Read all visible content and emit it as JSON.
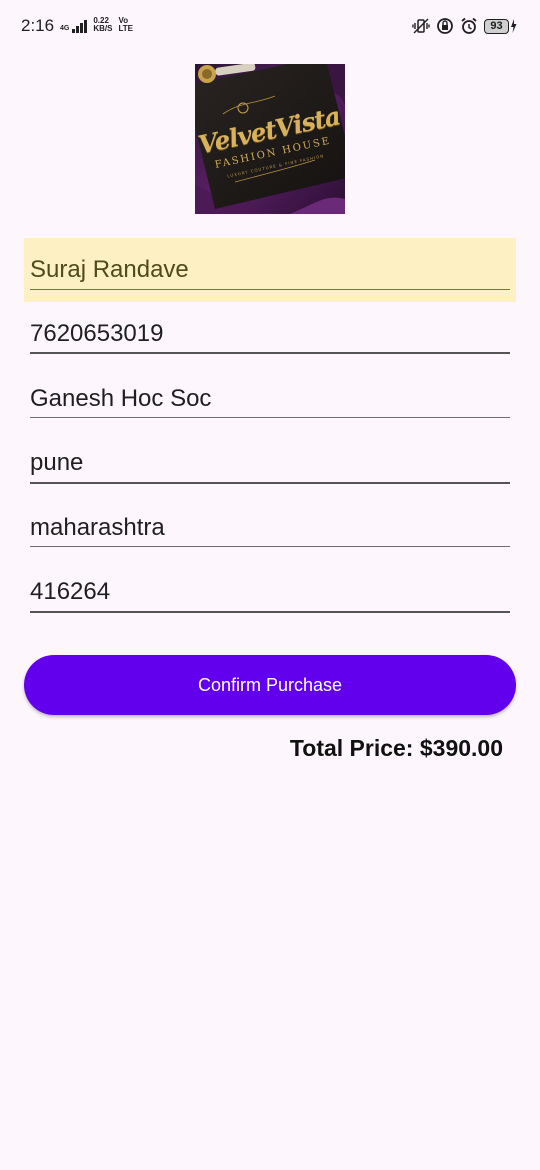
{
  "status_bar": {
    "time": "2:16",
    "network_type": "4G",
    "data_rate_value": "0.22",
    "data_rate_unit": "KB/S",
    "volte_top": "Vo",
    "volte_bottom": "LTE",
    "battery_level": "93",
    "icons": [
      "vibrate-icon",
      "data-saver-icon",
      "alarm-icon",
      "battery-icon",
      "charging-icon"
    ]
  },
  "logo": {
    "title": "VelvetVista",
    "subtitle": "FASHION HOUSE",
    "tagline": "LUXURY COUTURE & FINE FASHION",
    "colors": {
      "gold": "#d8b25a",
      "dark": "#1b1414",
      "velvet": "#4a1a55"
    }
  },
  "form": {
    "name": "Suraj Randave",
    "phone": "7620653019",
    "address": "Ganesh Hoc Soc",
    "city": "pune",
    "state": "maharashtra",
    "pincode": "416264"
  },
  "confirm_button": {
    "label": "Confirm Purchase",
    "color": "#6200ee"
  },
  "total": {
    "label": "Total Price: $390.00"
  },
  "theme": {
    "background": "#fdf6fd",
    "autofill_highlight": "#fdf1c4"
  }
}
